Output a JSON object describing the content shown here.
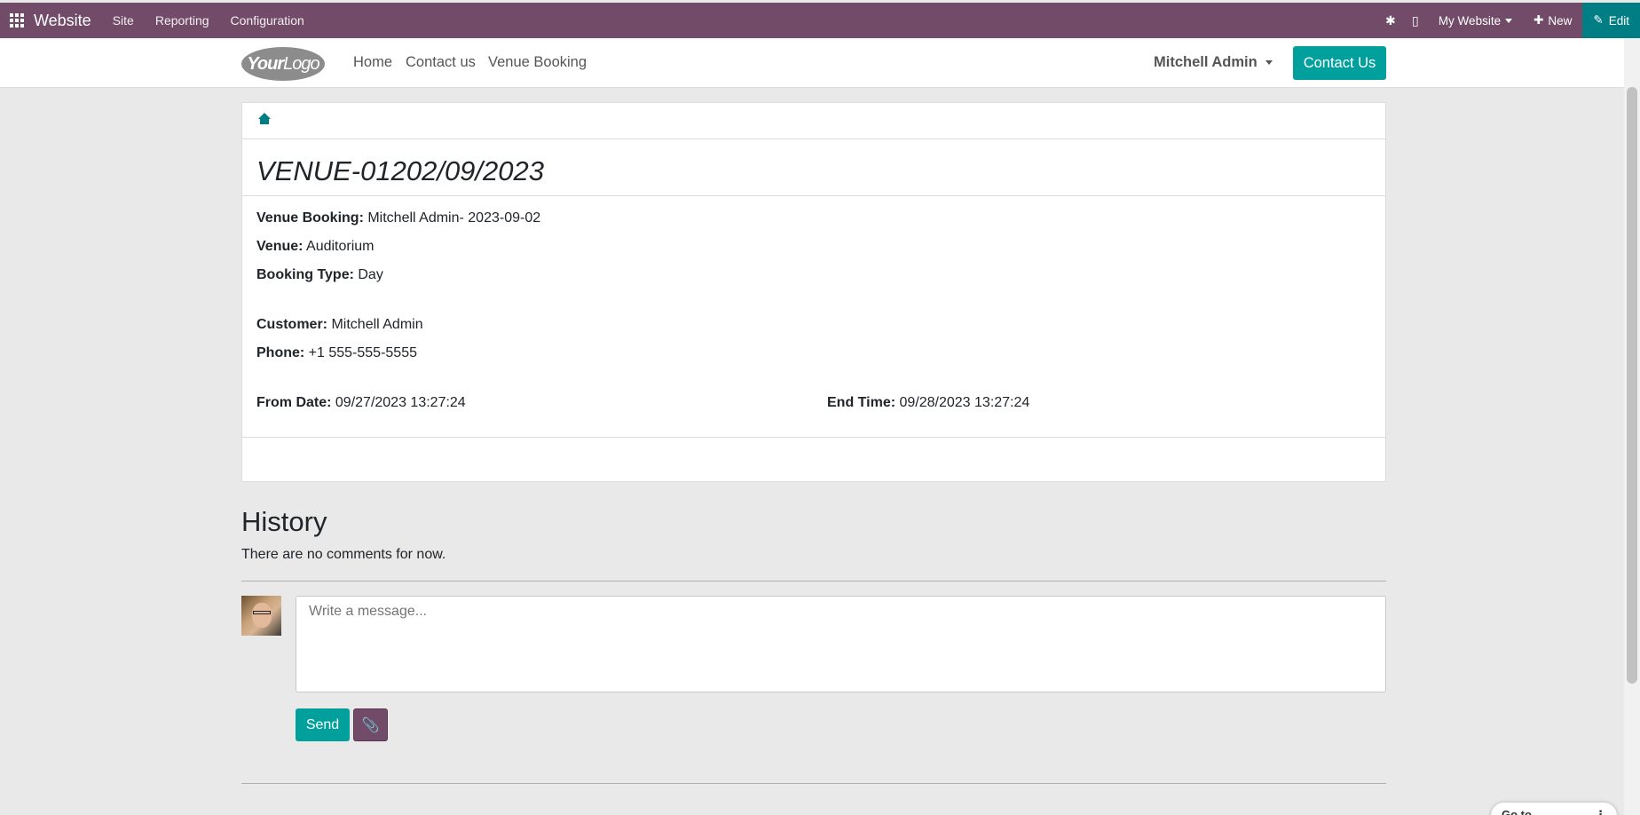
{
  "topbar": {
    "brand": "Website",
    "menus": [
      "Site",
      "Reporting",
      "Configuration"
    ],
    "my_website": "My Website",
    "new_label": "New",
    "edit_label": "Edit"
  },
  "site_header": {
    "logo_text_bold": "Your",
    "logo_text": "Logo",
    "nav": [
      "Home",
      "Contact us",
      "Venue Booking"
    ],
    "user": "Mitchell Admin",
    "contact_button": "Contact Us"
  },
  "booking": {
    "title": "VENUE-01202/09/2023",
    "venue_booking_label": "Venue Booking:",
    "venue_booking_value": " Mitchell Admin- 2023-09-02",
    "venue_label": "Venue:",
    "venue_value": " Auditorium",
    "booking_type_label": "Booking Type:",
    "booking_type_value": " Day",
    "customer_label": "Customer:",
    "customer_value": " Mitchell Admin",
    "phone_label": "Phone:",
    "phone_value": " +1 555-555-5555",
    "from_date_label": "From Date:",
    "from_date_value": " 09/27/2023 13:27:24",
    "end_time_label": "End Time:",
    "end_time_value": " 09/28/2023 13:27:24"
  },
  "history": {
    "title": "History",
    "empty_text": "There are no comments for now.",
    "message_placeholder": "Write a message...",
    "send_label": "Send"
  },
  "footer_tab": {
    "label": "Go to Frontend",
    "more": "⋮"
  },
  "colors": {
    "topbar": "#714b67",
    "primary": "#01a09d",
    "edit": "#017e84"
  }
}
